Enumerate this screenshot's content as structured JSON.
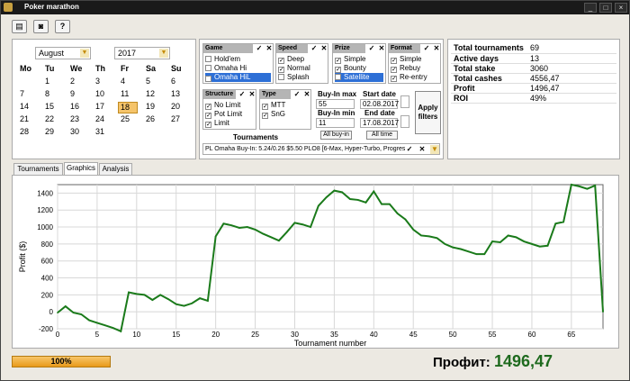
{
  "window": {
    "title": "Poker marathon"
  },
  "toolbar": {
    "icons": [
      "database-icon",
      "camera-icon",
      "help-icon"
    ]
  },
  "calendar": {
    "month": "August",
    "year": "2017",
    "weekdays": [
      "Mo",
      "Tu",
      "We",
      "Th",
      "Fr",
      "Sa",
      "Su"
    ],
    "rows": [
      [
        "",
        "1",
        "2",
        "3",
        "4",
        "5",
        "6"
      ],
      [
        "7",
        "8",
        "9",
        "10",
        "11",
        "12",
        "13"
      ],
      [
        "14",
        "15",
        "16",
        "17",
        "18",
        "19",
        "20"
      ],
      [
        "21",
        "22",
        "23",
        "24",
        "25",
        "26",
        "27"
      ],
      [
        "28",
        "29",
        "30",
        "31",
        "",
        "",
        ""
      ]
    ],
    "selected": "18"
  },
  "filters": {
    "game": {
      "header": "Game",
      "options": [
        {
          "label": "Hold'em",
          "checked": false
        },
        {
          "label": "Omaha Hi",
          "checked": false
        },
        {
          "label": "Omaha HiL",
          "checked": true,
          "highlight": true
        }
      ]
    },
    "speed": {
      "header": "Speed",
      "options": [
        {
          "label": "Deep",
          "checked": true
        },
        {
          "label": "Normal",
          "checked": true
        },
        {
          "label": "Splash",
          "checked": false
        }
      ]
    },
    "prize": {
      "header": "Prize",
      "options": [
        {
          "label": "Simple",
          "checked": true
        },
        {
          "label": "Bounty",
          "checked": true
        },
        {
          "label": "Satellite",
          "checked": false,
          "highlight": true
        }
      ]
    },
    "format": {
      "header": "Format",
      "options": [
        {
          "label": "Simple",
          "checked": true
        },
        {
          "label": "Rebuy",
          "checked": true
        },
        {
          "label": "Re-entry",
          "checked": true
        }
      ]
    },
    "structure": {
      "header": "Structure",
      "options": [
        {
          "label": "No Limit",
          "checked": true
        },
        {
          "label": "Pot Limit",
          "checked": true
        },
        {
          "label": "Limit",
          "checked": true
        }
      ]
    },
    "type": {
      "header": "Type",
      "options": [
        {
          "label": "MTT",
          "checked": true
        },
        {
          "label": "SnG",
          "checked": true
        }
      ]
    },
    "buyin_max_label": "Buy-In max",
    "buyin_max": "55",
    "buyin_min_label": "Buy-In min",
    "buyin_min": "11",
    "all_buyin": "All buy-in",
    "start_date_label": "Start date",
    "start_date": "02.08.2017",
    "end_date_label": "End date",
    "end_date": "17.08.2017",
    "all_time": "All time",
    "apply_line1": "Apply",
    "apply_line2": "filters",
    "tournaments_label": "Tournaments",
    "tournament_select": "PL Omaha Buy-In: 5.24/0.26 $5.50 PLO8 [6-Max, Hyper-Turbo, Progres"
  },
  "stats": [
    {
      "label": "Total tournaments",
      "value": "69"
    },
    {
      "label": "Active days",
      "value": "13"
    },
    {
      "label": "Total stake",
      "value": "3060"
    },
    {
      "label": "Total cashes",
      "value": "4556,47"
    },
    {
      "label": "Profit",
      "value": "1496,47"
    },
    {
      "label": "ROI",
      "value": "49%"
    }
  ],
  "tabs": [
    "Tournaments",
    "Graphics",
    "Analysis"
  ],
  "active_tab": "Graphics",
  "progress": {
    "label": "100%",
    "value": 1.0
  },
  "profit_label": "Профит:",
  "profit_value": "1496,47",
  "colors": {
    "line": "#1a7a1a",
    "accent": "#f0a020",
    "profit_text": "#1e6a1e"
  },
  "chart_data": {
    "type": "line",
    "xlabel": "Tournament number",
    "ylabel": "Profit ($)",
    "xlim": [
      0,
      69
    ],
    "ylim": [
      -200,
      1500
    ],
    "xticks": [
      0,
      5,
      10,
      15,
      20,
      25,
      30,
      35,
      40,
      45,
      50,
      55,
      60,
      65
    ],
    "yticks": [
      -200,
      0,
      200,
      400,
      600,
      800,
      1000,
      1200,
      1400
    ],
    "grid": true,
    "series": [
      {
        "x": [
          0,
          1,
          2,
          3,
          4,
          5,
          6,
          7,
          8,
          9,
          10,
          11,
          12,
          13,
          14,
          15,
          16,
          17,
          18,
          19,
          20,
          21,
          22,
          23,
          24,
          25,
          26,
          27,
          28,
          29,
          30,
          31,
          32,
          33,
          34,
          35,
          36,
          37,
          38,
          39,
          40,
          41,
          42,
          43,
          44,
          45,
          46,
          47,
          48,
          49,
          50,
          51,
          52,
          53,
          54,
          55,
          56,
          57,
          58,
          59,
          60,
          61,
          62,
          63,
          64,
          65,
          66,
          67,
          68,
          69
        ],
        "y": [
          -10,
          65,
          -10,
          -30,
          -100,
          -130,
          -160,
          -190,
          -230,
          230,
          210,
          200,
          140,
          200,
          150,
          90,
          70,
          100,
          160,
          130,
          890,
          1040,
          1020,
          990,
          1000,
          970,
          920,
          880,
          840,
          940,
          1050,
          1030,
          1000,
          1250,
          1350,
          1430,
          1410,
          1330,
          1320,
          1290,
          1420,
          1270,
          1270,
          1160,
          1090,
          970,
          900,
          890,
          870,
          800,
          760,
          740,
          710,
          680,
          680,
          830,
          820,
          900,
          880,
          830,
          800,
          770,
          780,
          1040,
          1060,
          1500,
          1480,
          1450,
          1490,
          0
        ]
      }
    ]
  }
}
